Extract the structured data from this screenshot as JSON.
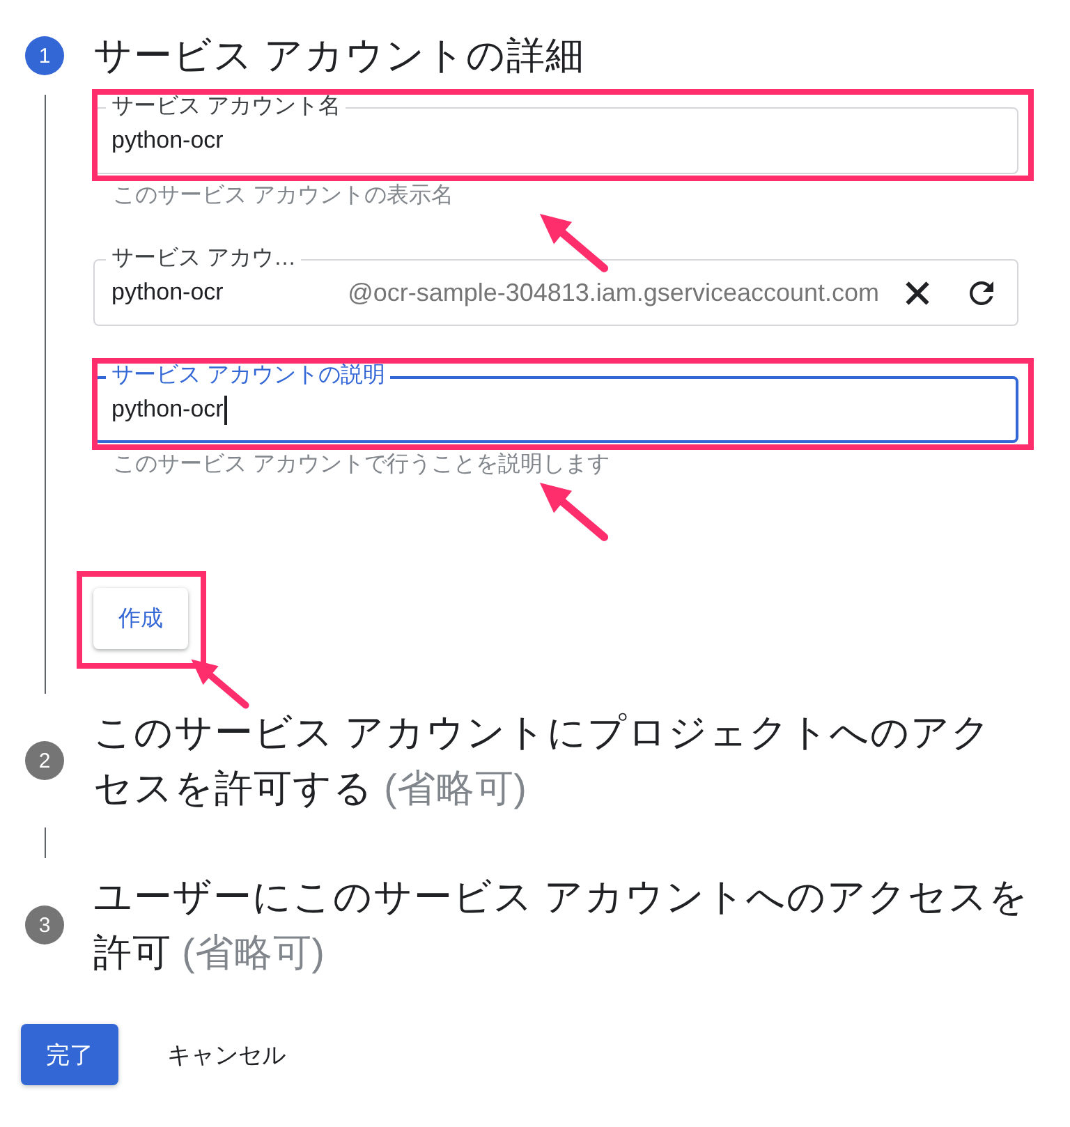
{
  "steps": [
    {
      "number": "1",
      "active": true,
      "title": "サービス アカウントの詳細",
      "fields": [
        {
          "kind": "text",
          "label": "サービス アカウント名",
          "value": "python-ocr",
          "helper": "このサービス アカウントの表示名",
          "focused": false,
          "highlighted": true
        },
        {
          "kind": "account_id",
          "label": "サービス アカウ…",
          "value": "python-ocr",
          "suffix": "@ocr-sample-304813.iam.gserviceaccount.com",
          "focused": false,
          "highlighted": false
        },
        {
          "kind": "text",
          "label": "サービス アカウントの説明",
          "value": "python-ocr",
          "helper": "このサービス アカウントで行うことを説明します",
          "focused": true,
          "highlighted": true
        }
      ],
      "create_button": {
        "label": "作成",
        "highlighted": true
      }
    },
    {
      "number": "2",
      "active": false,
      "title": "このサービス アカウントにプロジェクトへのアクセスを許可する",
      "optional": "(省略可)"
    },
    {
      "number": "3",
      "active": false,
      "title": "ユーザーにこのサービス アカウントへのアクセスを許可",
      "optional": "(省略可)"
    }
  ],
  "actions": [
    {
      "kind": "primary",
      "label": "完了"
    },
    {
      "kind": "text",
      "label": "キャンセル"
    }
  ]
}
